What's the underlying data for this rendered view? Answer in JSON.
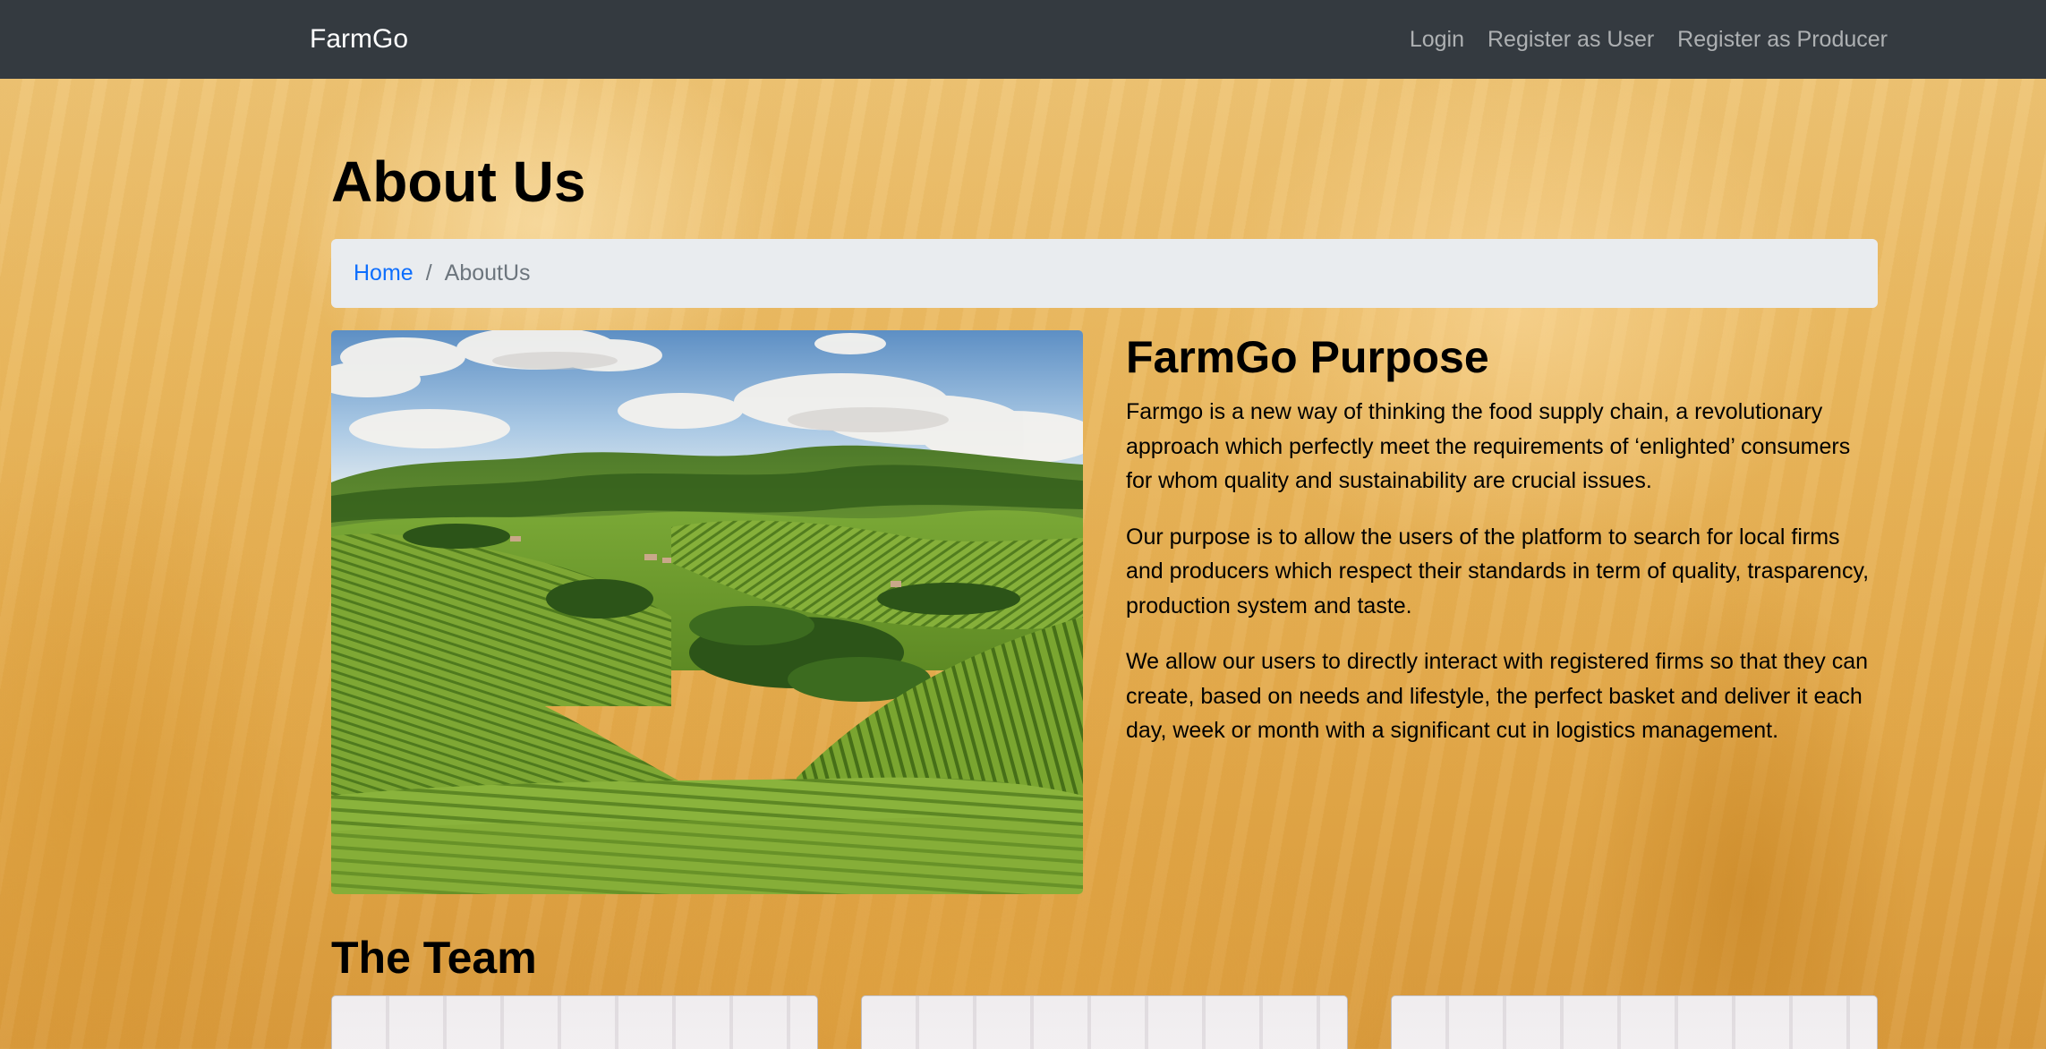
{
  "navbar": {
    "brand": "FarmGo",
    "links": [
      {
        "label": "Login"
      },
      {
        "label": "Register as User"
      },
      {
        "label": "Register as Producer"
      }
    ]
  },
  "page": {
    "title": "About Us"
  },
  "breadcrumb": {
    "home": "Home",
    "separator": "/",
    "current": "AboutUs"
  },
  "purpose": {
    "heading": "FarmGo Purpose",
    "paragraphs": [
      "Farmgo is a new way of thinking the food supply chain, a revolutionary approach which perfectly meet the requirements of ‘enlighted’ consumers for whom quality and sustainability are crucial issues.",
      "Our purpose is to allow the users of the platform to search for local firms and producers which respect their standards in term of quality, trasparency, production system and taste.",
      "We allow our users to directly interact with registered firms so that they can create, based on needs and lifestyle, the perfect basket and deliver it each day, week or month with a significant cut in logistics management."
    ]
  },
  "team": {
    "heading": "The Team",
    "members_visible": 3
  },
  "colors": {
    "navbar_bg": "#343a40",
    "link_blue": "#0d6efd",
    "breadcrumb_bg": "#e9ecef"
  }
}
